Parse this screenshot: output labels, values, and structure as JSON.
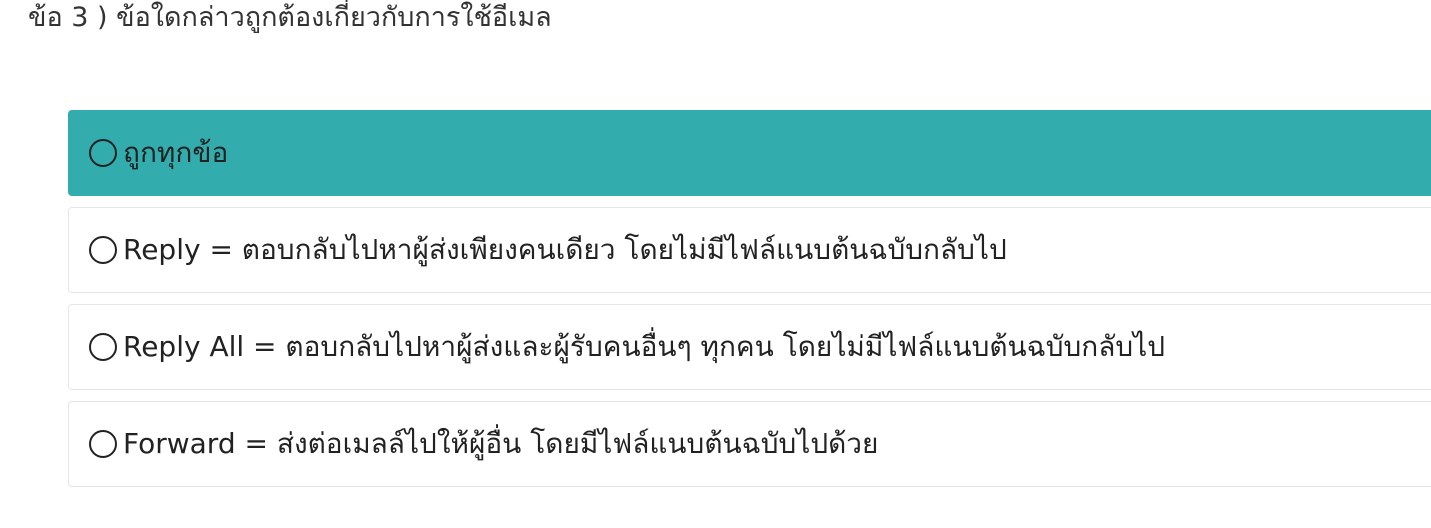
{
  "question": {
    "title": "ข้อ 3 ) ข้อใดกล่าวถูกต้องเกี่ยวกับการใช้อีเมล"
  },
  "choices": [
    {
      "label": "ถูกทุกข้อ",
      "selected": true
    },
    {
      "label": "Reply = ตอบกลับไปหาผู้ส่งเพียงคนเดียว โดยไม่มีไฟล์แนบต้นฉบับกลับไป",
      "selected": false
    },
    {
      "label": "Reply All = ตอบกลับไปหาผู้ส่งและผู้รับคนอื่นๆ ทุกคน โดยไม่มีไฟล์แนบต้นฉบับกลับไป",
      "selected": false
    },
    {
      "label": "Forward = ส่งต่อเมลล์ไปให้ผู้อื่น โดยมีไฟล์แนบต้นฉบับไปด้วย",
      "selected": false
    }
  ],
  "colors": {
    "selected_background": "#33acad",
    "border": "#e6e6e6"
  }
}
